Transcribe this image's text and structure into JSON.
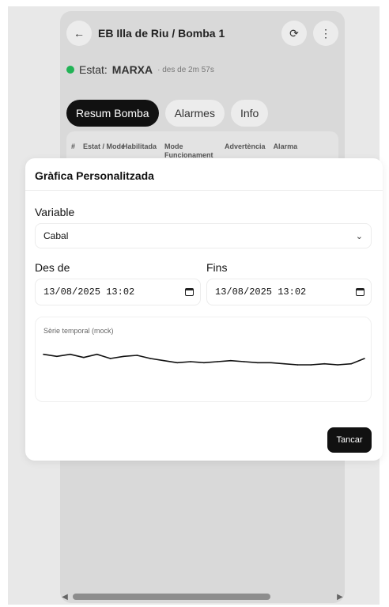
{
  "app": {
    "back_icon": "←",
    "title": "EB Illa de Riu / Bomba 1",
    "refresh_icon": "⟳",
    "menu_icon": "⋮"
  },
  "status": {
    "prefix": "Estat:",
    "value": "MARXA",
    "since": "· des de 2m 57s",
    "color": "#22b356"
  },
  "tabs": [
    {
      "label": "Resum Bomba",
      "active": true
    },
    {
      "label": "Alarmes",
      "active": false
    },
    {
      "label": "Info",
      "active": false
    }
  ],
  "table": {
    "headers": [
      "#",
      "Estat / Mode",
      "Habilitada",
      "Mode Funcionament",
      "Advertència",
      "Alarma"
    ]
  },
  "modal": {
    "title": "Gràfica Personalitzada",
    "variable_label": "Variable",
    "variable_value": "Cabal",
    "from_label": "Des de",
    "from_value": "13/08/2025 13:02",
    "to_label": "Fins",
    "to_value": "13/08/2025 13:02",
    "chart_caption": "Sèrie temporal (mock)",
    "close_label": "Tancar"
  },
  "chart_data": {
    "type": "line",
    "x": [
      0,
      1,
      2,
      3,
      4,
      5,
      6,
      7,
      8,
      9,
      10,
      11,
      12,
      13,
      14,
      15,
      16,
      17,
      18,
      19,
      20,
      21,
      22,
      23,
      24
    ],
    "values": [
      60,
      58,
      60,
      57,
      60,
      56,
      58,
      59,
      56,
      54,
      52,
      53,
      52,
      53,
      54,
      53,
      52,
      52,
      51,
      50,
      50,
      51,
      50,
      51,
      56
    ],
    "title": "Sèrie temporal (mock)",
    "xlabel": "",
    "ylabel": "",
    "ylim": [
      20,
      80
    ],
    "grid": false
  },
  "colors": {
    "accent": "#111111",
    "status_green": "#22b356"
  }
}
